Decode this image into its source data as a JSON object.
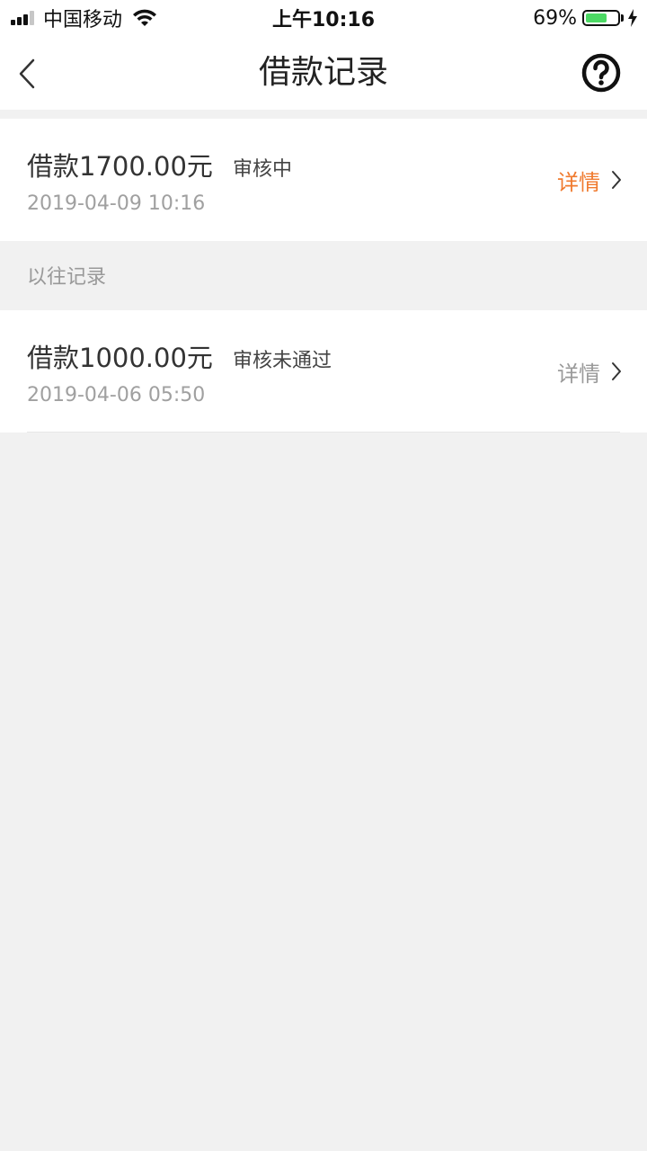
{
  "status_bar": {
    "carrier": "中国移动",
    "time": "上午10:16",
    "battery_percent": "69%",
    "battery_level": 0.69,
    "icons": [
      "signal-icon",
      "wifi-icon",
      "battery-icon",
      "charging-bolt-icon"
    ]
  },
  "nav": {
    "title": "借款记录",
    "back_icon": "chevron-left-icon",
    "help_icon": "question-circle-icon"
  },
  "current_record": {
    "amount": "借款1700.00元",
    "status": "审核中",
    "datetime": "2019-04-09 10:16",
    "detail_label": "详情",
    "detail_color": "#f07a2e"
  },
  "history": {
    "section_label": "以往记录",
    "records": [
      {
        "amount": "借款1000.00元",
        "status": "审核未通过",
        "datetime": "2019-04-06 05:50",
        "detail_label": "详情"
      }
    ]
  },
  "colors": {
    "accent": "#f07a2e",
    "background": "#f1f1f1",
    "battery_green": "#4cd964"
  }
}
